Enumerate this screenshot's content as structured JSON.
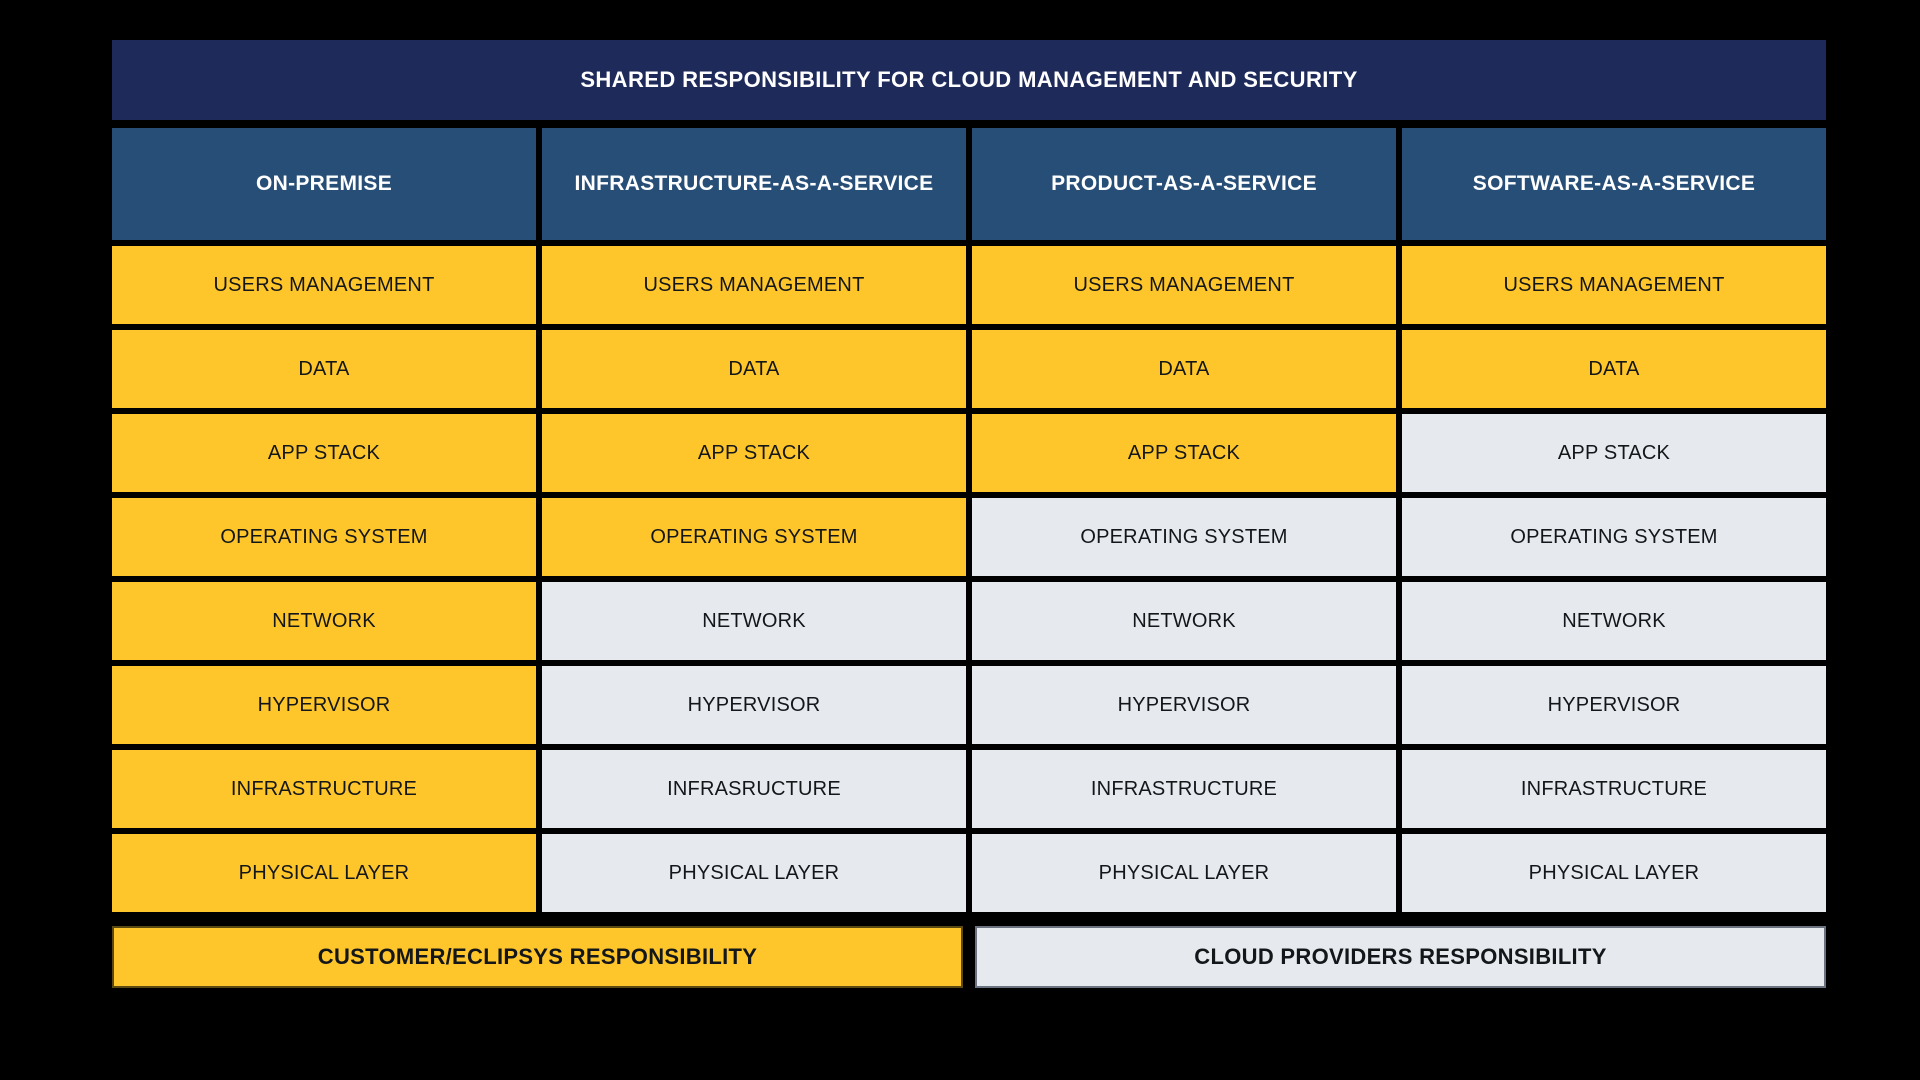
{
  "title": "SHARED RESPONSIBILITY FOR CLOUD MANAGEMENT AND SECURITY",
  "colors": {
    "title_bar": "#1E2A5A",
    "column_header": "#274E76",
    "customer": "#FFC62B",
    "provider": "#E6EAEE",
    "background": "#000000",
    "text_dark": "#14171A",
    "text_light": "#FFFFFF"
  },
  "columns": [
    {
      "label": "ON-PREMISE"
    },
    {
      "label": "INFRASTRUCTURE-AS-A-SERVICE"
    },
    {
      "label": "PRODUCT-AS-A-SERVICE"
    },
    {
      "label": "SOFTWARE-AS-A-SERVICE"
    }
  ],
  "rows": [
    {
      "name": "users-management",
      "cells": [
        {
          "label": "USERS MANAGEMENT",
          "owner": "customer"
        },
        {
          "label": "USERS MANAGEMENT",
          "owner": "customer"
        },
        {
          "label": "USERS MANAGEMENT",
          "owner": "customer"
        },
        {
          "label": "USERS MANAGEMENT",
          "owner": "customer"
        }
      ]
    },
    {
      "name": "data",
      "cells": [
        {
          "label": "DATA",
          "owner": "customer"
        },
        {
          "label": "DATA",
          "owner": "customer"
        },
        {
          "label": "DATA",
          "owner": "customer"
        },
        {
          "label": "DATA",
          "owner": "customer"
        }
      ]
    },
    {
      "name": "app-stack",
      "cells": [
        {
          "label": "APP STACK",
          "owner": "customer"
        },
        {
          "label": "APP STACK",
          "owner": "customer"
        },
        {
          "label": "APP STACK",
          "owner": "customer"
        },
        {
          "label": "APP STACK",
          "owner": "provider"
        }
      ]
    },
    {
      "name": "operating-system",
      "cells": [
        {
          "label": "OPERATING SYSTEM",
          "owner": "customer"
        },
        {
          "label": "OPERATING SYSTEM",
          "owner": "customer"
        },
        {
          "label": "OPERATING SYSTEM",
          "owner": "provider"
        },
        {
          "label": "OPERATING SYSTEM",
          "owner": "provider"
        }
      ]
    },
    {
      "name": "network",
      "cells": [
        {
          "label": "NETWORK",
          "owner": "customer"
        },
        {
          "label": "NETWORK",
          "owner": "provider"
        },
        {
          "label": "NETWORK",
          "owner": "provider"
        },
        {
          "label": "NETWORK",
          "owner": "provider"
        }
      ]
    },
    {
      "name": "hypervisor",
      "cells": [
        {
          "label": "HYPERVISOR",
          "owner": "customer"
        },
        {
          "label": "HYPERVISOR",
          "owner": "provider"
        },
        {
          "label": "HYPERVISOR",
          "owner": "provider"
        },
        {
          "label": "HYPERVISOR",
          "owner": "provider"
        }
      ]
    },
    {
      "name": "infrastructure",
      "cells": [
        {
          "label": "INFRASTRUCTURE",
          "owner": "customer"
        },
        {
          "label": "INFRASRUCTURE",
          "owner": "provider"
        },
        {
          "label": "INFRASTRUCTURE",
          "owner": "provider"
        },
        {
          "label": "INFRASTRUCTURE",
          "owner": "provider"
        }
      ]
    },
    {
      "name": "physical-layer",
      "cells": [
        {
          "label": "PHYSICAL LAYER",
          "owner": "customer"
        },
        {
          "label": "PHYSICAL LAYER",
          "owner": "provider"
        },
        {
          "label": "PHYSICAL LAYER",
          "owner": "provider"
        },
        {
          "label": "PHYSICAL LAYER",
          "owner": "provider"
        }
      ]
    }
  ],
  "legend": [
    {
      "label": "CUSTOMER/ECLIPSYS RESPONSIBILITY",
      "owner": "customer"
    },
    {
      "label": "CLOUD PROVIDERS RESPONSIBILITY",
      "owner": "provider"
    }
  ]
}
